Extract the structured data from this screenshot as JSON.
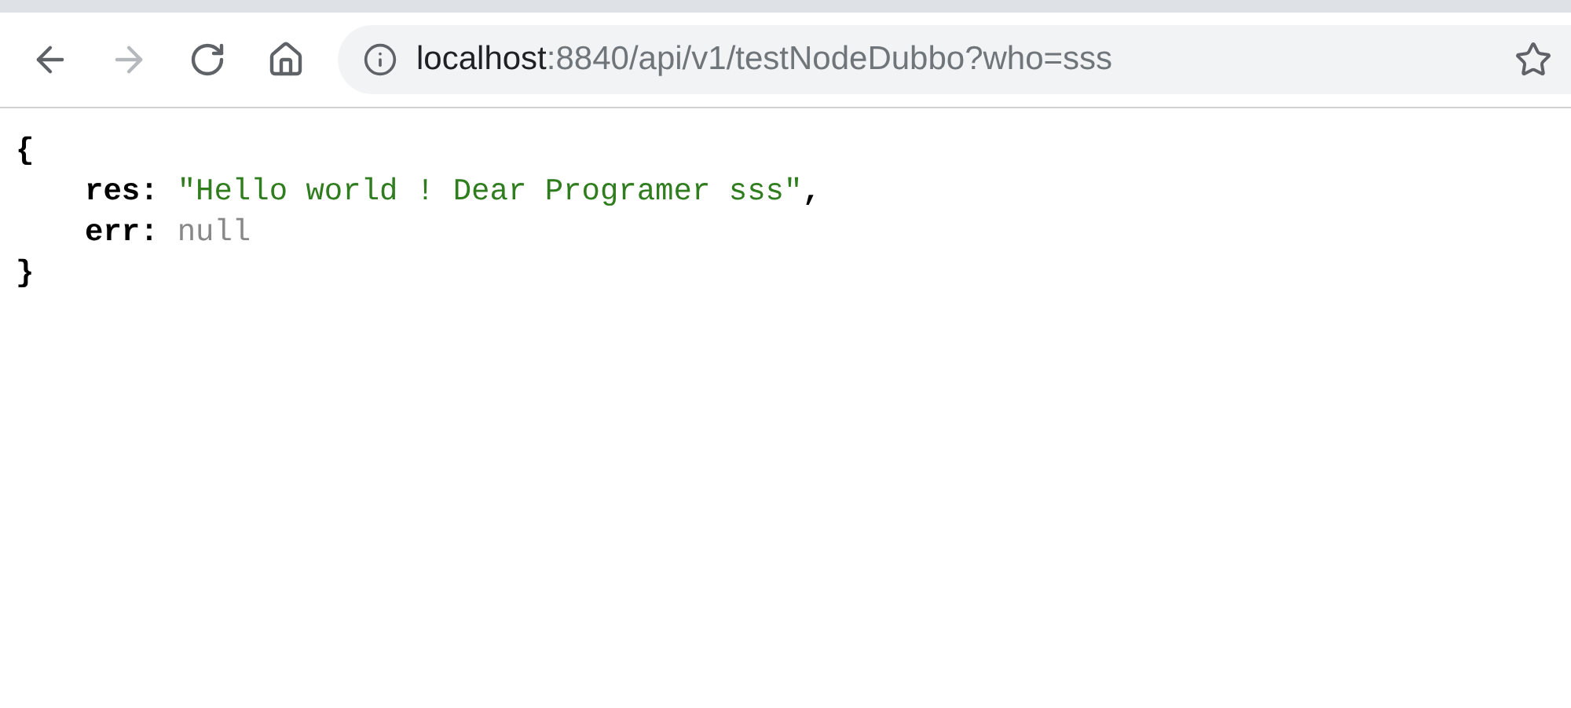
{
  "toolbar": {
    "back": {
      "disabled": false
    },
    "forward": {
      "disabled": true
    }
  },
  "address_bar": {
    "host": "localhost",
    "path": ":8840/api/v1/testNodeDubbo?who=sss"
  },
  "json_view": {
    "open": "{",
    "entries": [
      {
        "key": "res:",
        "value": "\"Hello world ! Dear Programer sss\"",
        "kind": "string",
        "separator": ","
      },
      {
        "key": "err:",
        "value": "null",
        "kind": "null"
      }
    ],
    "close": "}"
  }
}
